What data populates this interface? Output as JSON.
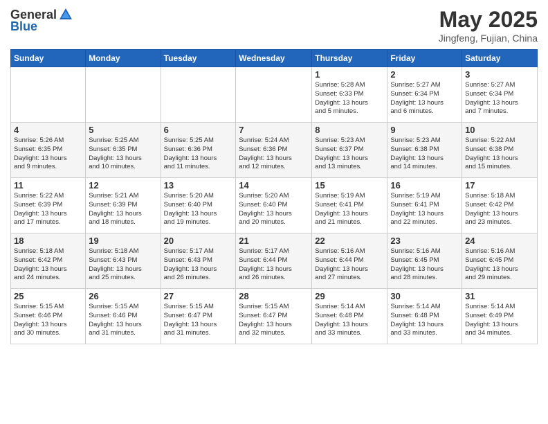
{
  "header": {
    "logo_general": "General",
    "logo_blue": "Blue",
    "month": "May 2025",
    "location": "Jingfeng, Fujian, China"
  },
  "weekdays": [
    "Sunday",
    "Monday",
    "Tuesday",
    "Wednesday",
    "Thursday",
    "Friday",
    "Saturday"
  ],
  "weeks": [
    [
      {
        "day": "",
        "info": ""
      },
      {
        "day": "",
        "info": ""
      },
      {
        "day": "",
        "info": ""
      },
      {
        "day": "",
        "info": ""
      },
      {
        "day": "1",
        "info": "Sunrise: 5:28 AM\nSunset: 6:33 PM\nDaylight: 13 hours\nand 5 minutes."
      },
      {
        "day": "2",
        "info": "Sunrise: 5:27 AM\nSunset: 6:34 PM\nDaylight: 13 hours\nand 6 minutes."
      },
      {
        "day": "3",
        "info": "Sunrise: 5:27 AM\nSunset: 6:34 PM\nDaylight: 13 hours\nand 7 minutes."
      }
    ],
    [
      {
        "day": "4",
        "info": "Sunrise: 5:26 AM\nSunset: 6:35 PM\nDaylight: 13 hours\nand 9 minutes."
      },
      {
        "day": "5",
        "info": "Sunrise: 5:25 AM\nSunset: 6:35 PM\nDaylight: 13 hours\nand 10 minutes."
      },
      {
        "day": "6",
        "info": "Sunrise: 5:25 AM\nSunset: 6:36 PM\nDaylight: 13 hours\nand 11 minutes."
      },
      {
        "day": "7",
        "info": "Sunrise: 5:24 AM\nSunset: 6:36 PM\nDaylight: 13 hours\nand 12 minutes."
      },
      {
        "day": "8",
        "info": "Sunrise: 5:23 AM\nSunset: 6:37 PM\nDaylight: 13 hours\nand 13 minutes."
      },
      {
        "day": "9",
        "info": "Sunrise: 5:23 AM\nSunset: 6:38 PM\nDaylight: 13 hours\nand 14 minutes."
      },
      {
        "day": "10",
        "info": "Sunrise: 5:22 AM\nSunset: 6:38 PM\nDaylight: 13 hours\nand 15 minutes."
      }
    ],
    [
      {
        "day": "11",
        "info": "Sunrise: 5:22 AM\nSunset: 6:39 PM\nDaylight: 13 hours\nand 17 minutes."
      },
      {
        "day": "12",
        "info": "Sunrise: 5:21 AM\nSunset: 6:39 PM\nDaylight: 13 hours\nand 18 minutes."
      },
      {
        "day": "13",
        "info": "Sunrise: 5:20 AM\nSunset: 6:40 PM\nDaylight: 13 hours\nand 19 minutes."
      },
      {
        "day": "14",
        "info": "Sunrise: 5:20 AM\nSunset: 6:40 PM\nDaylight: 13 hours\nand 20 minutes."
      },
      {
        "day": "15",
        "info": "Sunrise: 5:19 AM\nSunset: 6:41 PM\nDaylight: 13 hours\nand 21 minutes."
      },
      {
        "day": "16",
        "info": "Sunrise: 5:19 AM\nSunset: 6:41 PM\nDaylight: 13 hours\nand 22 minutes."
      },
      {
        "day": "17",
        "info": "Sunrise: 5:18 AM\nSunset: 6:42 PM\nDaylight: 13 hours\nand 23 minutes."
      }
    ],
    [
      {
        "day": "18",
        "info": "Sunrise: 5:18 AM\nSunset: 6:42 PM\nDaylight: 13 hours\nand 24 minutes."
      },
      {
        "day": "19",
        "info": "Sunrise: 5:18 AM\nSunset: 6:43 PM\nDaylight: 13 hours\nand 25 minutes."
      },
      {
        "day": "20",
        "info": "Sunrise: 5:17 AM\nSunset: 6:43 PM\nDaylight: 13 hours\nand 26 minutes."
      },
      {
        "day": "21",
        "info": "Sunrise: 5:17 AM\nSunset: 6:44 PM\nDaylight: 13 hours\nand 26 minutes."
      },
      {
        "day": "22",
        "info": "Sunrise: 5:16 AM\nSunset: 6:44 PM\nDaylight: 13 hours\nand 27 minutes."
      },
      {
        "day": "23",
        "info": "Sunrise: 5:16 AM\nSunset: 6:45 PM\nDaylight: 13 hours\nand 28 minutes."
      },
      {
        "day": "24",
        "info": "Sunrise: 5:16 AM\nSunset: 6:45 PM\nDaylight: 13 hours\nand 29 minutes."
      }
    ],
    [
      {
        "day": "25",
        "info": "Sunrise: 5:15 AM\nSunset: 6:46 PM\nDaylight: 13 hours\nand 30 minutes."
      },
      {
        "day": "26",
        "info": "Sunrise: 5:15 AM\nSunset: 6:46 PM\nDaylight: 13 hours\nand 31 minutes."
      },
      {
        "day": "27",
        "info": "Sunrise: 5:15 AM\nSunset: 6:47 PM\nDaylight: 13 hours\nand 31 minutes."
      },
      {
        "day": "28",
        "info": "Sunrise: 5:15 AM\nSunset: 6:47 PM\nDaylight: 13 hours\nand 32 minutes."
      },
      {
        "day": "29",
        "info": "Sunrise: 5:14 AM\nSunset: 6:48 PM\nDaylight: 13 hours\nand 33 minutes."
      },
      {
        "day": "30",
        "info": "Sunrise: 5:14 AM\nSunset: 6:48 PM\nDaylight: 13 hours\nand 33 minutes."
      },
      {
        "day": "31",
        "info": "Sunrise: 5:14 AM\nSunset: 6:49 PM\nDaylight: 13 hours\nand 34 minutes."
      }
    ]
  ]
}
